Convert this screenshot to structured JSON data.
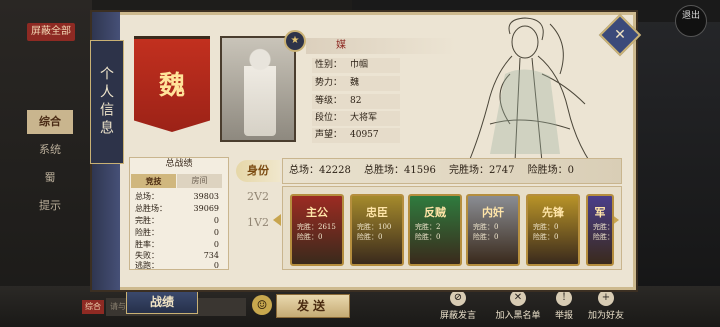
{
  "bg": {
    "block_all": "屏蔽全部",
    "sidebar": [
      "综合",
      "系统",
      "蜀",
      "提示"
    ],
    "chat_tag": "综合",
    "chat_placeholder": "请与好友发言",
    "send": "发送",
    "emoji": "☺",
    "corner": "退出",
    "actions": [
      {
        "icon": "block-icon",
        "label": "屏蔽发言"
      },
      {
        "icon": "blacklist-icon",
        "label": "加入黑名单"
      },
      {
        "icon": "report-icon",
        "label": "举报"
      },
      {
        "icon": "add-friend-icon",
        "label": "加为好友"
      }
    ]
  },
  "panel": {
    "title": "个人信息",
    "close_icon": "close-icon",
    "faction_char": "魏",
    "portrait_badge": "★",
    "name": "媒",
    "info": [
      {
        "k": "性别：",
        "v": "巾帼"
      },
      {
        "k": "势力：",
        "v": "魏"
      },
      {
        "k": "等级：",
        "v": "82"
      },
      {
        "k": "段位：",
        "v": "大将军"
      },
      {
        "k": "声望：",
        "v": "40957"
      }
    ]
  },
  "stats": {
    "title": "总战绩",
    "tabs": [
      "竞技",
      "房间"
    ],
    "rows": [
      {
        "k": "总场：",
        "v": "39803"
      },
      {
        "k": "总胜场：",
        "v": "39069"
      },
      {
        "k": "完胜：",
        "v": "0"
      },
      {
        "k": "险胜：",
        "v": "0"
      },
      {
        "k": "胜率：",
        "v": "0"
      },
      {
        "k": "失败：",
        "v": "734"
      },
      {
        "k": "逃跑：",
        "v": "0"
      }
    ]
  },
  "modes": [
    "身份",
    "2V2",
    "1V2"
  ],
  "summary": {
    "total": "总场：42228",
    "wins": "总胜场：41596",
    "full": "完胜场：2747",
    "narrow": "险胜场：0"
  },
  "roles": [
    {
      "name": "主公",
      "l1": "完胜：2615",
      "l2": "险胜：0",
      "color": "#9c2b22"
    },
    {
      "name": "忠臣",
      "l1": "完胜：100",
      "l2": "险胜：0",
      "color": "#a58a2c"
    },
    {
      "name": "反贼",
      "l1": "完胜：2",
      "l2": "险胜：0",
      "color": "#2f7b3e"
    },
    {
      "name": "内奸",
      "l1": "完胜：0",
      "l2": "险胜：0",
      "color": "#8a8d93"
    },
    {
      "name": "先锋",
      "l1": "完胜：0",
      "l2": "险胜：0",
      "color": "#b89328"
    },
    {
      "name": "军",
      "l1": "完胜：0",
      "l2": "险胜：0",
      "color": "#4a3e8a"
    }
  ],
  "zhanji": "战绩"
}
